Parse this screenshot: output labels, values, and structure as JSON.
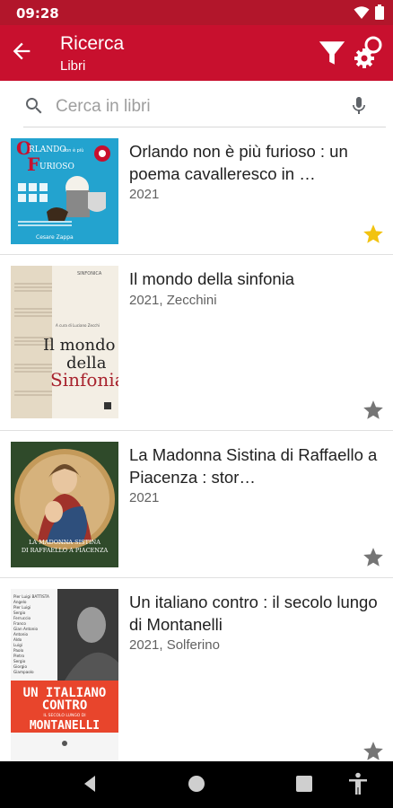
{
  "status": {
    "time": "09:28"
  },
  "appbar": {
    "title": "Ricerca",
    "subtitle": "Libri"
  },
  "search": {
    "placeholder": "Cerca in libri",
    "value": ""
  },
  "books": [
    {
      "title": "Orlando non è più furioso : un poema cavalleresco in …",
      "meta": "2021",
      "starred": true,
      "cover": {
        "line1": "RLANDO",
        "line1b": "non è più",
        "line2": "URIOSO",
        "author": "Cesare Zappa"
      }
    },
    {
      "title": "Il mondo della sinfonia",
      "meta": "2021, Zecchini",
      "starred": false,
      "cover": {
        "top": "SINFONICA",
        "curator": "A cura di Luciano Zecchi",
        "line1": "Il mondo",
        "line2": "della",
        "line3": "Sinfonia"
      }
    },
    {
      "title": "La Madonna Sistina di Raffaello a Piacenza : stor…",
      "meta": "2021",
      "starred": false,
      "cover": {
        "line1": "LA MADONNA SISTINA",
        "line2": "DI RAFFAELLO A PIACENZA"
      }
    },
    {
      "title": "Un italiano contro : il secolo lungo di Montanelli",
      "meta": "2021, Solferino",
      "starred": false,
      "cover": {
        "line1": "UN ITALIANO",
        "line2": "CONTRO",
        "line3": "IL SECOLO LUNGO DI",
        "line4": "MONTANELLI",
        "names": [
          "Pier Luigi BATTISTA",
          "Angelo",
          "Pier Luigi",
          "Sergio",
          "Ferruccio",
          "Franco",
          "Gian Antonio",
          "Antonio",
          "Aldo",
          "Luigi",
          "Paolo",
          "Pietro",
          "Sergio",
          "Giorgio",
          "Giampaolo"
        ]
      }
    }
  ],
  "colors": {
    "primary": "#c8102e",
    "statusbar": "#b2162b",
    "star_active": "#f2c311",
    "star_inactive": "#757575"
  }
}
